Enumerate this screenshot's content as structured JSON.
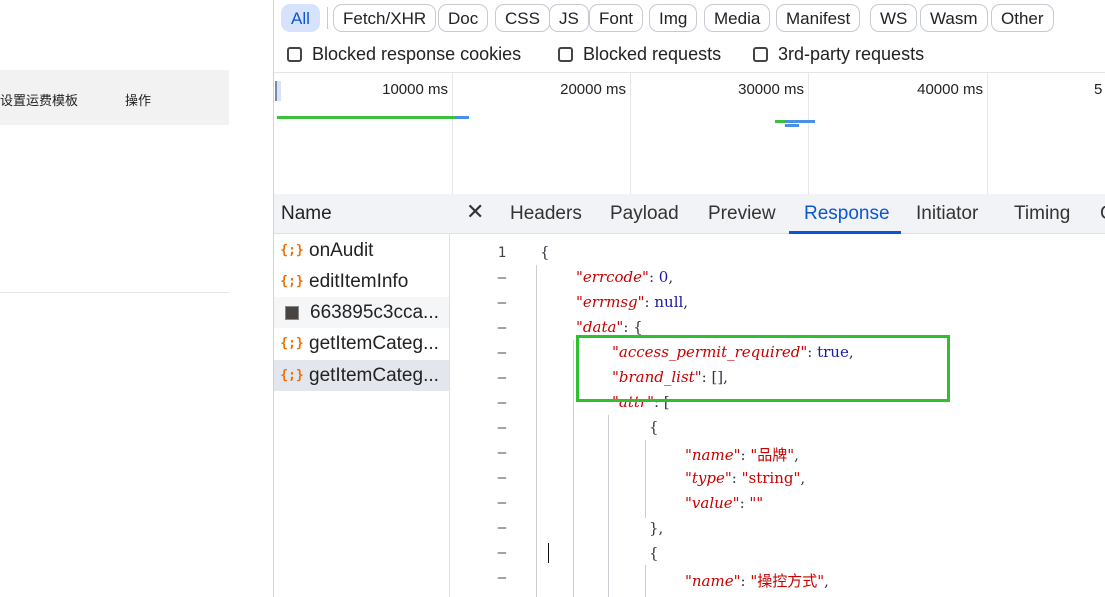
{
  "left_app": {
    "columns": [
      "设置运费模板",
      "操作"
    ]
  },
  "devtools": {
    "filters": [
      "All",
      "Fetch/XHR",
      "Doc",
      "CSS",
      "JS",
      "Font",
      "Img",
      "Media",
      "Manifest",
      "WS",
      "Wasm",
      "Other"
    ],
    "active_filter": "All",
    "checkboxes": [
      "Blocked response cookies",
      "Blocked requests",
      "3rd-party requests"
    ],
    "timeline": {
      "ticks": [
        "10000 ms",
        "20000 ms",
        "30000 ms",
        "40000 ms",
        "5"
      ],
      "bar_colors": {
        "green": "#3cbf3c",
        "blue": "#4a8fe8"
      }
    },
    "name_header": "Name",
    "requests": [
      {
        "name": "onAudit",
        "icon": "fetch-icon"
      },
      {
        "name": "editItemInfo",
        "icon": "fetch-icon"
      },
      {
        "name": "663895c3cca...",
        "icon": "image-thumbnail-icon"
      },
      {
        "name": "getItemCateg...",
        "icon": "fetch-icon"
      },
      {
        "name": "getItemCateg...",
        "icon": "fetch-icon",
        "selected": true
      }
    ],
    "tabs": [
      "Headers",
      "Payload",
      "Preview",
      "Response",
      "Initiator",
      "Timing",
      "C"
    ],
    "active_tab": "Response",
    "line_numbers": [
      "1",
      "–",
      "–",
      "–",
      "–",
      "–",
      "–",
      "–",
      "–",
      "–",
      "–",
      "–",
      "–",
      "–"
    ],
    "code": {
      "open_brace": "{",
      "errcode_key": "\"errcode\"",
      "errcode_val": "0",
      "errmsg_key": "\"errmsg\"",
      "errmsg_val": "null",
      "data_key": "\"data\"",
      "data_open": "{",
      "apr_key": "\"access_permit_required\"",
      "apr_val": "true",
      "brand_key": "\"brand_list\"",
      "brand_val": "[]",
      "attr_key": "\"attr\"",
      "attr_open": "[",
      "obj_open": "{",
      "name_key": "\"name\"",
      "name_val1": "\"品牌\"",
      "type_key": "\"type\"",
      "type_val": "\"string\"",
      "value_key": "\"value\"",
      "value_val": "\"\"",
      "obj_close": "},",
      "name_val2": "\"操控方式\""
    },
    "highlight_color": "#2fbf2f"
  }
}
